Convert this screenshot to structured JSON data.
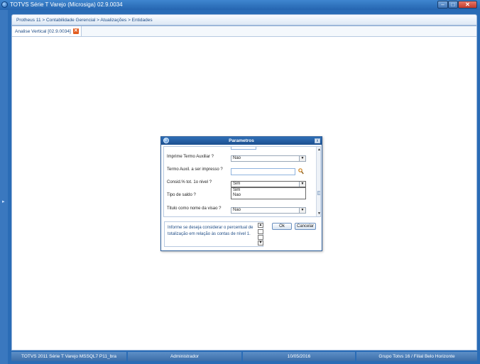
{
  "window": {
    "title": "TOTVS Série T Varejo (Microsiga) 02.9.0034",
    "minimize": "–",
    "maximize": "□",
    "close": "✕"
  },
  "breadcrumb": "Protheus 11 > Contabilidade Gerencial > Atualizações > Entidades",
  "tab": {
    "label": "Analise Vertical [02.9.0034]",
    "close": "✕"
  },
  "dialog": {
    "title": "Parametros",
    "close": "x",
    "params": [
      {
        "label": "Imprime Termo Auxiliar ?",
        "value": "Nao"
      },
      {
        "label": "Termo Auxil. a ser impresso ?",
        "value": ""
      },
      {
        "label": "Consid.% tot. 1o nivel ?",
        "value": "Sim"
      },
      {
        "label": "Tipo de saldo ?",
        "value": ""
      },
      {
        "label": "Titulo como nome da visao ?",
        "value": "Nao"
      }
    ],
    "dropdown_options": [
      "Sim",
      "Nao"
    ],
    "help_text": "Informe se deseja considerar o percentual de totalização em relação às contas de nível 1.",
    "ok_label": "Ok",
    "cancel_label": "Cancelar"
  },
  "status_bar": [
    "TOTVS 2011 Série T Varejo MSSQL7 P11_bra",
    "Administrador",
    "10/05/2016",
    "Grupo Totvs 16 / Filial Belo Horizonte"
  ]
}
